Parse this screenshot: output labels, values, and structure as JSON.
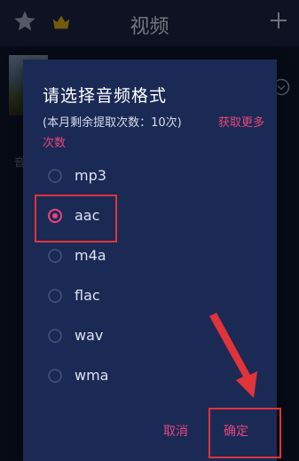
{
  "topbar": {
    "title": "视频"
  },
  "background": {
    "side_text": "音"
  },
  "dialog": {
    "title": "请选择音频格式",
    "subtitle": "(本月剩余提取次数：10次)",
    "more_link_line1": "获取更多",
    "more_link_line2": "次数",
    "options": [
      {
        "label": "mp3",
        "selected": false
      },
      {
        "label": "aac",
        "selected": true
      },
      {
        "label": "m4a",
        "selected": false
      },
      {
        "label": "flac",
        "selected": false
      },
      {
        "label": "wav",
        "selected": false
      },
      {
        "label": "wma",
        "selected": false
      }
    ],
    "cancel_label": "取消",
    "ok_label": "确定"
  },
  "colors": {
    "accent": "#e8457a",
    "highlight": "#e0333a",
    "dialog_bg": "#1a2a55"
  }
}
